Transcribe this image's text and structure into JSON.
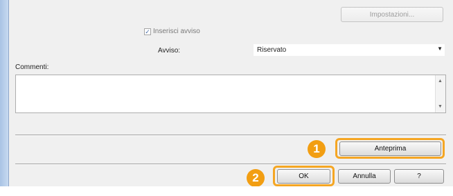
{
  "settings_button": "Impostazioni...",
  "insert_notice_label": "Inserisci avviso",
  "notice_label": "Avviso:",
  "notice_value": "Riservato",
  "comments_label": "Commenti:",
  "comments_value": "",
  "preview_button": "Anteprima",
  "ok_button": "OK",
  "cancel_button": "Annulla",
  "help_button": "?",
  "badges": [
    "1",
    "2"
  ],
  "icons": [
    "chevron-down-icon",
    "scroll-up-icon",
    "scroll-down-icon",
    "checkmark-icon"
  ],
  "colors": {
    "highlight": "#f5a623",
    "badge": "#f29e12",
    "dialog_bg": "#f0f0f0"
  }
}
